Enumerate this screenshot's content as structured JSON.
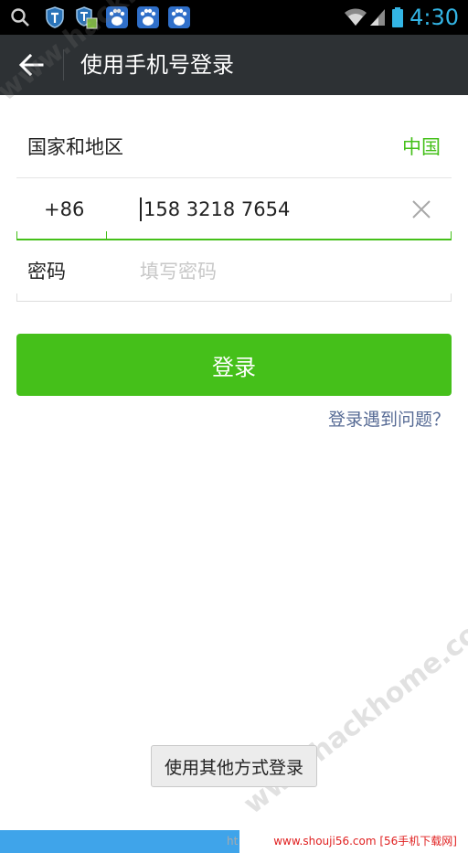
{
  "status_bar": {
    "time": "4:30",
    "icons": [
      "search-icon",
      "shield-icon",
      "shield-box-icon",
      "baidu-paw-icon",
      "baidu-paw-icon",
      "baidu-paw-icon",
      "wifi-icon",
      "signal-icon",
      "battery-icon"
    ],
    "time_color": "#33b5e5"
  },
  "title_bar": {
    "title": "使用手机号登录",
    "back_icon": "back-arrow-icon"
  },
  "form": {
    "country_label": "国家和地区",
    "country_value": "中国",
    "phone_code": "+86",
    "phone_value": "158 3218 7654",
    "clear_icon": "clear-x-icon",
    "password_label": "密码",
    "password_placeholder": "填写密码"
  },
  "actions": {
    "login_label": "登录",
    "problem_link": "登录遇到问题？",
    "other_methods_label": "使用其他方式登录"
  },
  "footer": {
    "partial_text": "ht",
    "site_text": "www.shouji56.com [56手机下载网]"
  },
  "watermark": {
    "text_top": "www.hackhome.com",
    "text_bottom": "www.hackhome.com"
  },
  "colors": {
    "accent": "#45c01a",
    "title_bar": "#2d3134",
    "link": "#576b95"
  }
}
